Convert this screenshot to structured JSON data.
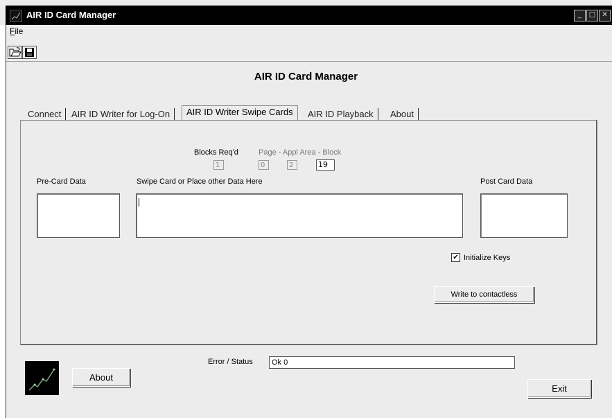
{
  "window": {
    "title": "AIR ID Card Manager"
  },
  "menu": {
    "file": "File"
  },
  "toolbar": {
    "open_icon": "open-folder-icon",
    "save_icon": "floppy-disk-icon"
  },
  "heading": "AIR ID Card Manager",
  "tabs": [
    {
      "label": "Connect",
      "active": false
    },
    {
      "label": "AIR ID Writer for Log-On",
      "active": false
    },
    {
      "label": "AIR ID Writer Swipe Cards",
      "active": true
    },
    {
      "label": "AIR ID Playback",
      "active": false
    },
    {
      "label": "About",
      "active": false
    }
  ],
  "swipe_tab": {
    "blocks_reqd_label": "Blocks Req'd",
    "page_label": "Page - Appl Area - Block",
    "blocks_reqd_value": "1",
    "page_value": "0",
    "appl_area_value": "2",
    "block_value": "19",
    "pre_card_label": "Pre-Card Data",
    "swipe_label": "Swipe Card or Place other Data Here",
    "post_card_label": "Post Card Data",
    "pre_card_value": "",
    "swipe_value": "",
    "post_card_value": "",
    "initialize_keys_label": "Initialize Keys",
    "initialize_keys_checked": true,
    "write_button": "Write to contactless"
  },
  "footer": {
    "about_button": "About",
    "error_status_label": "Error / Status",
    "status_value": "Ok 0",
    "exit_button": "Exit"
  }
}
